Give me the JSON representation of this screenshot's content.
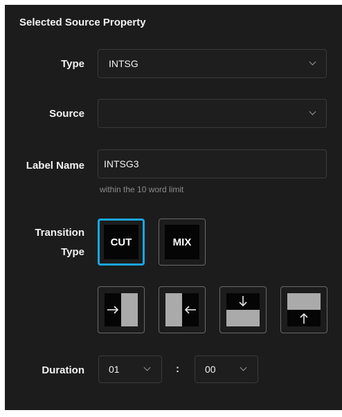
{
  "panel": {
    "title": "Selected Source Property"
  },
  "type_field": {
    "label": "Type",
    "value": "INTSG"
  },
  "source_field": {
    "label": "Source",
    "value": ""
  },
  "label_name_field": {
    "label": "Label Name",
    "value": "INTSG3",
    "hint": "within the 10 word limit"
  },
  "transition": {
    "label_line1": "Transition",
    "label_line2": "Type",
    "options": [
      "CUT",
      "MIX"
    ],
    "selected": "CUT",
    "wipes": [
      "wipe-left-icon",
      "wipe-right-icon",
      "wipe-down-icon",
      "wipe-up-icon"
    ]
  },
  "duration": {
    "label": "Duration",
    "minutes": "01",
    "separator": ":",
    "seconds": "00"
  },
  "colors": {
    "background": "#1c1c1c",
    "accent": "#1aa6e0",
    "field_border": "#3a3a3a"
  }
}
